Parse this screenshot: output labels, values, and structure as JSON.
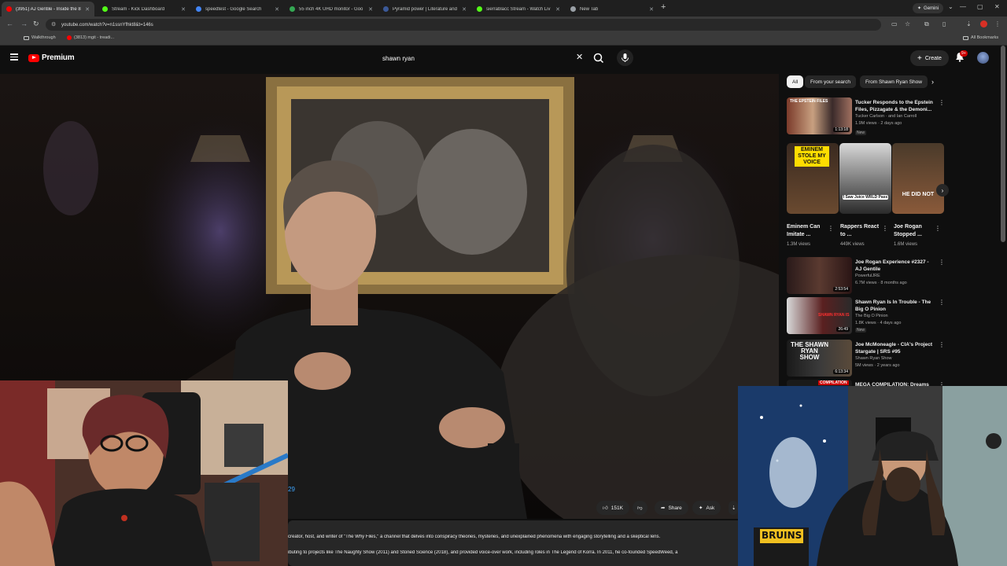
{
  "browser": {
    "tabs": [
      {
        "label": "(3951) AJ Gentile - Inside the 8",
        "active": true,
        "favicon_color": "#ff0000"
      },
      {
        "label": "Stream - Kick Dashboard",
        "active": false,
        "favicon_color": "#53fc18"
      },
      {
        "label": "speedtest - Google Search",
        "active": false,
        "favicon_color": "#4285f4"
      },
      {
        "label": "55 inch 4K UHD monitor - Goo",
        "active": false,
        "favicon_color": "#34a853"
      },
      {
        "label": "Pyramid power | Literature and",
        "active": false,
        "favicon_color": "#3b5998"
      },
      {
        "label": "sierrablacc Stream - Watch Liv",
        "active": false,
        "favicon_color": "#53fc18"
      },
      {
        "label": "New Tab",
        "active": false,
        "favicon_color": "#9aa0a6"
      }
    ],
    "gemini_label": "Gemini",
    "url": "youtube.com/watch?v=n1ssnYfhkt8&t=146s",
    "bookmarks": [
      {
        "label": "Walkthrough"
      },
      {
        "label": "(3813) mgit - treadi..."
      }
    ],
    "all_bookmarks_label": "All Bookmarks"
  },
  "youtube": {
    "logo_text": "Premium",
    "search_value": "shawn ryan",
    "create_label": "Create",
    "notification_count": "9+",
    "like_count": "151K",
    "share_label": "Share",
    "ask_label": "Ask",
    "timestamp_partial": "29",
    "description_lines": [
      "creator, host, and writer of \"The Why Files,\" a channel that delves into conspiracy theories, mysteries, and unexplained phenomena with engaging storytelling and a skeptical lens.",
      "ibuting to projects like The Naughty Show (2011) and Stoned Science (2018), and provided voice-over work, including roles in The Legend of Korra. In 2011, he co-founded SpeedWeed, a"
    ],
    "chips": [
      {
        "label": "All",
        "selected": true
      },
      {
        "label": "From your search",
        "selected": false
      },
      {
        "label": "From Shawn Ryan Show",
        "selected": false
      }
    ],
    "recommendations_top": [
      {
        "title": "Tucker Responds to the Epstein Files, Pizzagate & the Demoni...",
        "channel": "Tucker Carlson · and Ian Carroll",
        "meta": "1.9M views · 2 days ago",
        "badge": "New",
        "duration": "1:13:18",
        "thumb_text": "THE EPSTEIN FILES"
      }
    ],
    "shelf": [
      {
        "title": "Eminem Can Imitate ...",
        "views": "1.3M views",
        "thumb_text": "EMINEM STOLE MY VOICE"
      },
      {
        "title": "Rappers React to ...",
        "views": "449K views",
        "thumb_text": "I Saw Juice WRLD Pass"
      },
      {
        "title": "Joe Rogan Stopped ...",
        "views": "1.6M views",
        "thumb_text": "HE DID NOT"
      }
    ],
    "recommendations_bottom": [
      {
        "title": "Joe Rogan Experience #2327 - AJ Gentile",
        "channel": "PowerfulJRE",
        "meta": "6.7M views · 8 months ago",
        "badge": "",
        "duration": "2:53:54",
        "thumb_text": ""
      },
      {
        "title": "Shawn Ryan Is In Trouble - The Big O Pinion",
        "channel": "The Big O Pinion",
        "meta": "1.8K views · 4 days ago",
        "badge": "New",
        "duration": "26:49",
        "thumb_text": "SHAWN RYAN IS"
      },
      {
        "title": "Joe McMoneagle - CIA's Project Stargate | SRS #95",
        "channel": "Shawn Ryan Show",
        "meta": "5M views · 2 years ago",
        "badge": "",
        "duration": "6:13:34",
        "thumb_text": "THE SHAWN RYAN SHOW"
      },
      {
        "title": "MEGA COMPILATION: Dreams",
        "channel": "",
        "meta": "",
        "badge": "",
        "duration": "",
        "thumb_text": "COMPILATION"
      }
    ]
  }
}
